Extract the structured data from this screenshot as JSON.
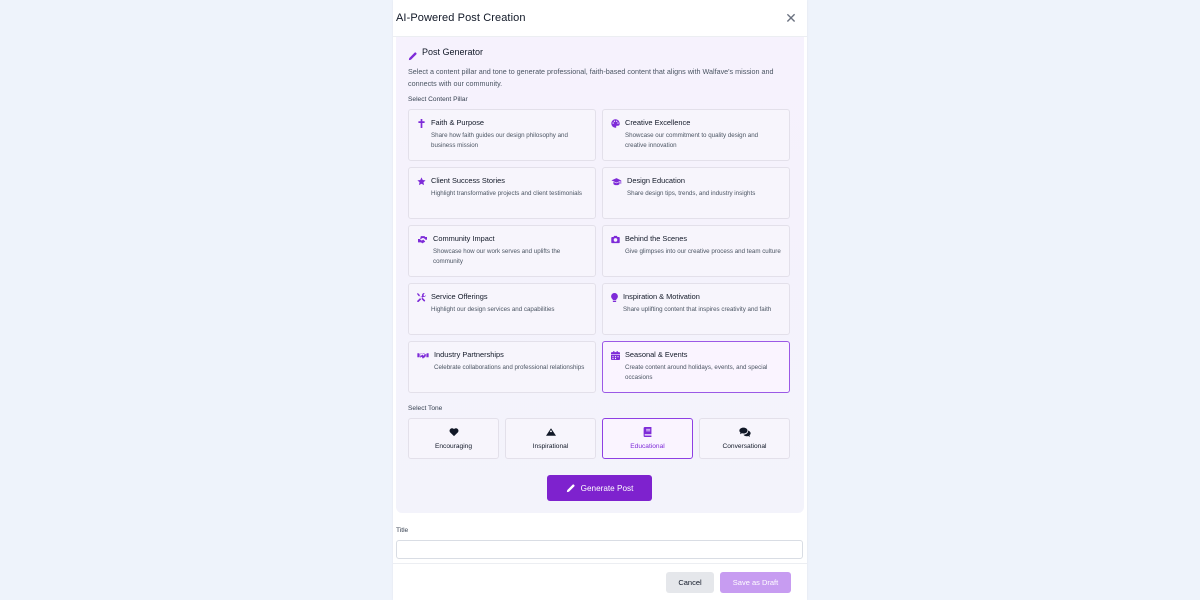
{
  "modal": {
    "title": "AI-Powered Post Creation",
    "close_symbol": "✕"
  },
  "generator": {
    "title": "Post Generator",
    "icon": "pencil-icon",
    "description": "Select a content pillar and tone to generate professional, faith-based content that aligns with Walfave's mission and connects with our community.",
    "pillar_section_label": "Select Content Pillar",
    "pillars": [
      {
        "title": "Faith & Purpose",
        "description": "Share how faith guides our design philosophy and business mission",
        "icon": "cross-icon",
        "selected": false
      },
      {
        "title": "Creative Excellence",
        "description": "Showcase our commitment to quality design and creative innovation",
        "icon": "palette-icon",
        "selected": false
      },
      {
        "title": "Client Success Stories",
        "description": "Highlight transformative projects and client testimonials",
        "icon": "star-icon",
        "selected": false
      },
      {
        "title": "Design Education",
        "description": "Share design tips, trends, and industry insights",
        "icon": "graduation-cap-icon",
        "selected": false
      },
      {
        "title": "Community Impact",
        "description": "Showcase how our work serves and uplifts the community",
        "icon": "hands-helping-icon",
        "selected": false
      },
      {
        "title": "Behind the Scenes",
        "description": "Give glimpses into our creative process and team culture",
        "icon": "camera-icon",
        "selected": false
      },
      {
        "title": "Service Offerings",
        "description": "Highlight our design services and capabilities",
        "icon": "tools-icon",
        "selected": false
      },
      {
        "title": "Inspiration & Motivation",
        "description": "Share uplifting content that inspires creativity and faith",
        "icon": "lightbulb-icon",
        "selected": false
      },
      {
        "title": "Industry Partnerships",
        "description": "Celebrate collaborations and professional relationships",
        "icon": "handshake-icon",
        "selected": false
      },
      {
        "title": "Seasonal & Events",
        "description": "Create content around holidays, events, and special occasions",
        "icon": "calendar-icon",
        "selected": true
      }
    ],
    "tone_section_label": "Select Tone",
    "tones": [
      {
        "label": "Encouraging",
        "icon": "heart-icon",
        "selected": false
      },
      {
        "label": "Inspirational",
        "icon": "mountain-icon",
        "selected": false
      },
      {
        "label": "Educational",
        "icon": "book-icon",
        "selected": true
      },
      {
        "label": "Conversational",
        "icon": "comments-icon",
        "selected": false
      }
    ],
    "generate_label": "Generate Post"
  },
  "title_field": {
    "label": "Title",
    "value": "",
    "placeholder": ""
  },
  "footer": {
    "cancel_label": "Cancel",
    "draft_label": "Save as Draft"
  },
  "colors": {
    "accent": "#7e22ce",
    "accent_light": "#c79cf1",
    "icon_purple": "#7e2bd8"
  }
}
